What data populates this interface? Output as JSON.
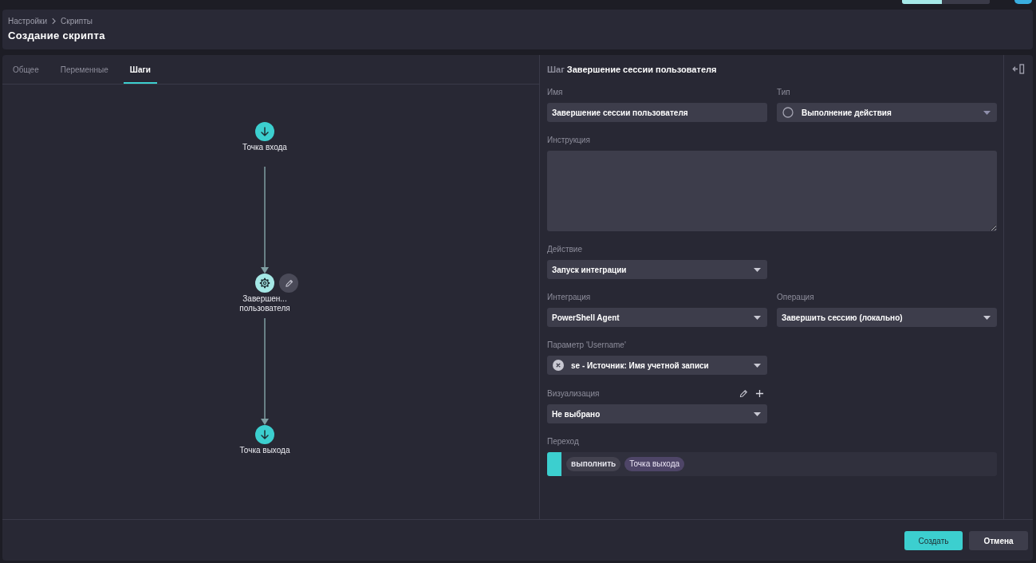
{
  "top_toggle": {
    "segments": [
      {
        "selected": true
      },
      {
        "selected": false
      }
    ]
  },
  "breadcrumb": {
    "parent": "Настройки",
    "current": "Скрипты"
  },
  "page_title": "Создание скрипта",
  "tabs": [
    {
      "label": "Общее",
      "selected": false
    },
    {
      "label": "Переменные",
      "selected": false
    },
    {
      "label": "Шаги",
      "selected": true
    }
  ],
  "flow": {
    "nodes": [
      {
        "kind": "entry",
        "label": "Точка входа",
        "selected": false
      },
      {
        "kind": "action",
        "label": "Завершен... пользователя",
        "selected": true
      },
      {
        "kind": "exit",
        "label": "Точка выхода",
        "selected": false
      }
    ]
  },
  "step": {
    "prefix": "Шаг",
    "title": "Завершение сессии пользователя"
  },
  "form": {
    "name": {
      "label": "Имя",
      "value": "Завершение сессии пользователя"
    },
    "type": {
      "label": "Тип",
      "value": "Выполнение действия"
    },
    "instruction": {
      "label": "Инструкция"
    },
    "action": {
      "label": "Действие",
      "value": "Запуск интеграции"
    },
    "integration": {
      "label": "Интеграция",
      "value": "PowerShell Agent"
    },
    "operation": {
      "label": "Операция",
      "value": "Завершить сессию (локально)"
    },
    "parameter": {
      "label": "Параметр 'Username'",
      "value": "se - Источник: Имя учетной записи"
    },
    "visualization": {
      "label": "Визуализация",
      "value": "Не выбрано"
    },
    "transition": {
      "label": "Переход",
      "items": [
        {
          "color": "#3ccfcf",
          "condition": "выполнить",
          "target": "Точка выхода"
        }
      ]
    }
  },
  "buttons": {
    "create": "Создать",
    "cancel": "Отмена"
  }
}
